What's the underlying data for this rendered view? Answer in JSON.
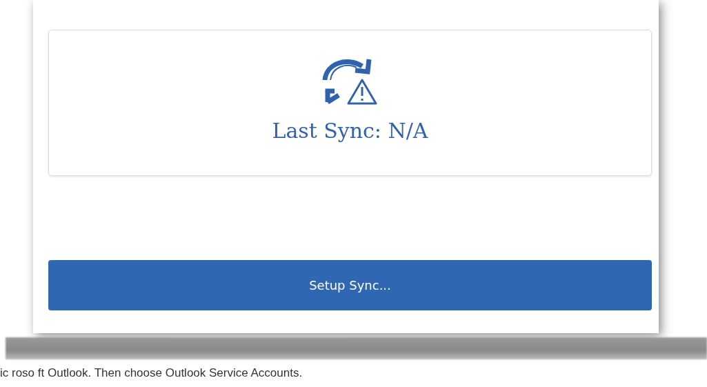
{
  "sync_card": {
    "status_text": "Last Sync: N/A"
  },
  "setup_button": {
    "label": "Setup Sync..."
  },
  "caption": "ic roso ft Outlook.  Then choose Outlook Service Accounts."
}
